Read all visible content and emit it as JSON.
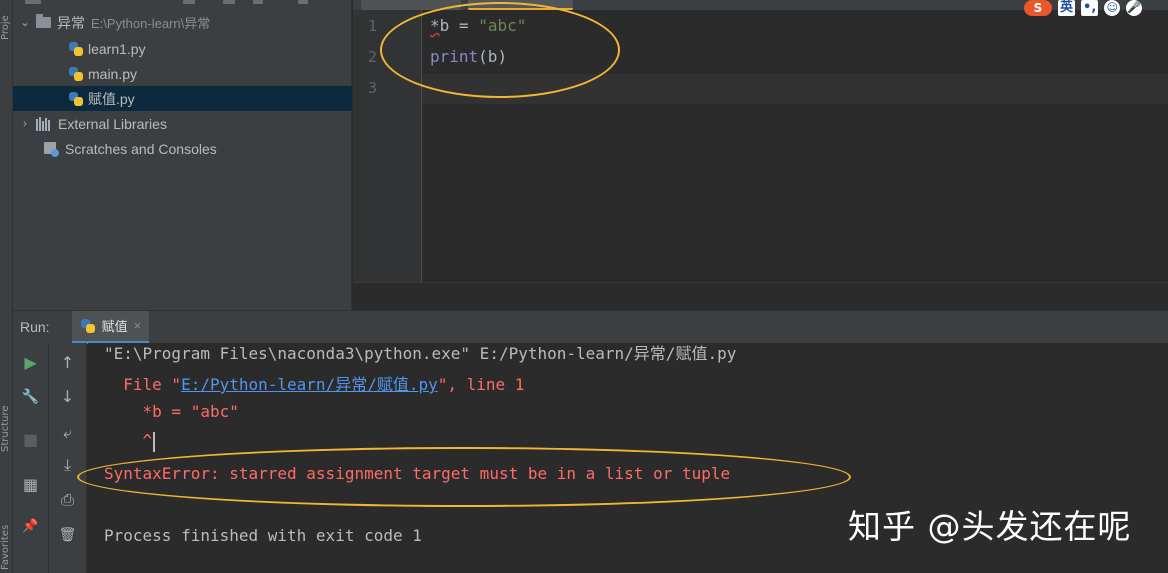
{
  "left_strip": {
    "project_label": "Proje",
    "structure_label": "Structure",
    "favorites_label": "Favorites"
  },
  "project_tree": {
    "root": {
      "name": "异常",
      "path": "E:\\Python-learn\\异常"
    },
    "files": [
      "learn1.py",
      "main.py",
      "赋值.py"
    ],
    "selected_file": "赋值.py",
    "external_libraries": "External Libraries",
    "scratches": "Scratches and Consoles"
  },
  "editor": {
    "line_numbers": [
      "1",
      "2",
      "3"
    ],
    "line1": {
      "star": "*",
      "var": "b",
      "op": " = ",
      "str": "\"abc\""
    },
    "line2": {
      "func": "print",
      "args": "(b)"
    }
  },
  "tray": {
    "ime_badge": "S",
    "ime_lang": "英",
    "punct": "•,",
    "emoji": "☺",
    "mic": "🎤"
  },
  "run": {
    "label": "Run:",
    "tab": "赋值",
    "tab_close": "×",
    "tools_left": {
      "run_icon": "▶",
      "wrench_icon": "🔧",
      "stop_icon": "■",
      "layout_icon": "▦",
      "pin_icon": "📌"
    },
    "tools_right": {
      "up_icon": "↑",
      "down_icon": "↓",
      "wrap_icon": "⤶",
      "scroll_end_icon": "⤓",
      "print_icon": "⎙",
      "trash_icon": "🗑"
    }
  },
  "console": {
    "command": "\"E:\\Program Files\\naconda3\\python.exe\" E:/Python-learn/异常/赋值.py",
    "file_prefix": "  File \"",
    "file_link": "E:/Python-learn/异常/赋值.py",
    "file_suffix": "\", line 1",
    "code": "    *b = \"abc\"",
    "pointer": "    ^",
    "error": "SyntaxError: starred assignment target must be in a list or tuple",
    "exit": "Process finished with exit code 1"
  },
  "watermark": "知乎 @头发还在呢",
  "colors": {
    "annotation": "#f2b632",
    "error": "#ff6b68",
    "link": "#5394ec",
    "string": "#6a8759",
    "builtin": "#8888c6"
  }
}
